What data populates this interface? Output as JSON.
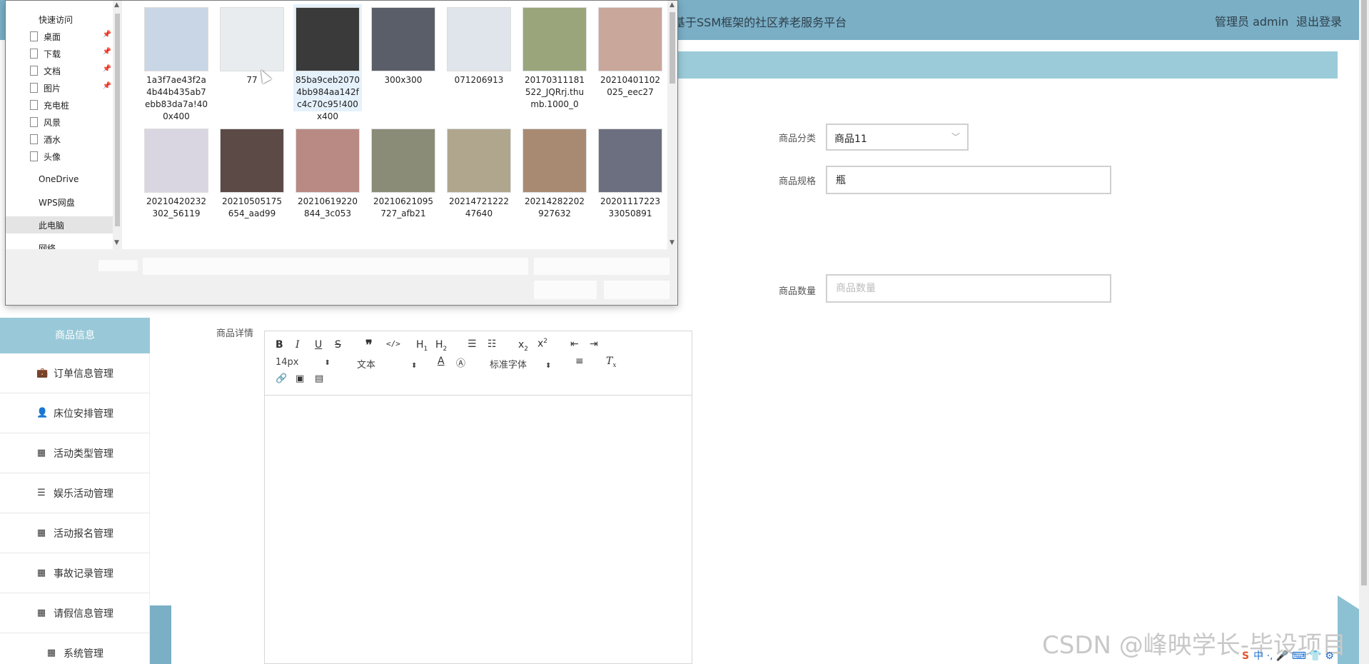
{
  "header": {
    "title": "基于SSM框架的社区养老服务平台",
    "user": "管理员 admin",
    "logout": "退出登录"
  },
  "form": {
    "category_label": "商品分类",
    "category_value": "商品11",
    "spec_label": "商品规格",
    "spec_value": "瓶",
    "quantity_label": "商品数量",
    "quantity_placeholder": "商品数量",
    "detail_label": "商品详情"
  },
  "editor": {
    "font_size": "14px",
    "paragraph": "文本",
    "font_family": "标准字体"
  },
  "sidebar": {
    "active": "商品信息",
    "items": [
      {
        "label": "订单信息管理",
        "icon": "briefcase-icon"
      },
      {
        "label": "床位安排管理",
        "icon": "user-icon"
      },
      {
        "label": "活动类型管理",
        "icon": "grid-icon"
      },
      {
        "label": "娱乐活动管理",
        "icon": "sliders-icon"
      },
      {
        "label": "活动报名管理",
        "icon": "grid-icon"
      },
      {
        "label": "事故记录管理",
        "icon": "grid-icon"
      },
      {
        "label": "请假信息管理",
        "icon": "grid-icon"
      },
      {
        "label": "系统管理",
        "icon": "grid-icon"
      }
    ]
  },
  "dialog": {
    "nav": [
      {
        "label": "快速访问",
        "type": "header"
      },
      {
        "label": "桌面",
        "type": "pinned"
      },
      {
        "label": "下载",
        "type": "pinned"
      },
      {
        "label": "文档",
        "type": "pinned"
      },
      {
        "label": "图片",
        "type": "pinned"
      },
      {
        "label": "充电桩",
        "type": "folder"
      },
      {
        "label": "风景",
        "type": "folder"
      },
      {
        "label": "酒水",
        "type": "folder"
      },
      {
        "label": "头像",
        "type": "folder"
      },
      {
        "label": "OneDrive",
        "type": "root"
      },
      {
        "label": "WPS网盘",
        "type": "root"
      },
      {
        "label": "此电脑",
        "type": "root-selected"
      },
      {
        "label": "网络",
        "type": "root"
      }
    ],
    "files": [
      {
        "name": "1a3f7ae43f2a4b44b435ab7ebb83da7a!400x400",
        "color": "#c8d6e6"
      },
      {
        "name": "77",
        "color": "#e8ecef"
      },
      {
        "name": "85ba9ceb20704bb984aa142fc4c70c95!400x400",
        "color": "#3a3a3a",
        "selected": true
      },
      {
        "name": "300x300",
        "color": "#5a5e68"
      },
      {
        "name": "071206913",
        "color": "#dfe5ea"
      },
      {
        "name": "20170311181522_JQRrj.thumb.1000_0",
        "color": "#9aa57c"
      },
      {
        "name": "20210401102025_eec27",
        "color": "#c9a79a"
      },
      {
        "name": "20210420232302_56119",
        "color": "#d9d6e2"
      },
      {
        "name": "20210505175654_aad99",
        "color": "#5b4a46"
      },
      {
        "name": "20210619220844_3c053",
        "color": "#b98a84"
      },
      {
        "name": "20210621095727_afb21",
        "color": "#8a8c78"
      },
      {
        "name": "2021472122247640",
        "color": "#b0a68e"
      },
      {
        "name": "20214282202927632",
        "color": "#a88a73"
      },
      {
        "name": "2020111722333050891",
        "color": "#6c6f7f"
      },
      {
        "name": "",
        "color": "#6e5c4d"
      },
      {
        "name": "",
        "color": "#c7a894"
      },
      {
        "name": "",
        "color": "#8f9aa8"
      },
      {
        "name": "",
        "color": "#3b3533"
      },
      {
        "name": "",
        "color": "#a4c1c8"
      },
      {
        "name": "",
        "color": "#b9a49b"
      },
      {
        "name": "",
        "color": "#8a7f85"
      }
    ]
  },
  "watermark": "CSDN @峰映学长-毕设项目",
  "tray": "中 ·, 🎤 ⌨ 👕 ⚙"
}
